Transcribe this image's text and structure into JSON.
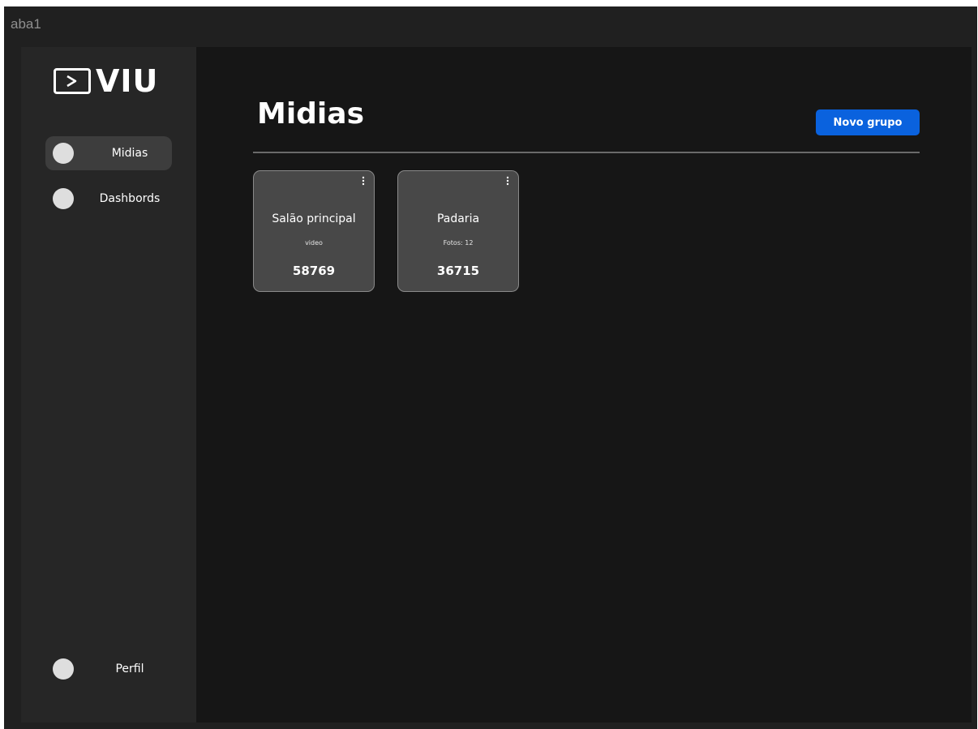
{
  "window": {
    "title": "aba1"
  },
  "brand": {
    "name": "VIU",
    "logo_icon": "play-box-icon"
  },
  "sidebar": {
    "items": [
      {
        "label": "Midias",
        "active": true
      },
      {
        "label": "Dashbords",
        "active": false
      }
    ],
    "profile": {
      "label": "Perfil"
    }
  },
  "main": {
    "title": "Midias",
    "new_group_label": "Novo grupo",
    "cards": [
      {
        "title": "Salão principal",
        "subtitle": "video",
        "value": "58769"
      },
      {
        "title": "Padaria",
        "subtitle": "Fotos: 12",
        "value": "36715"
      }
    ]
  },
  "colors": {
    "accent": "#0A62DE",
    "sidebar_bg": "#262626",
    "main_bg": "#161616",
    "card_bg": "#484848"
  }
}
